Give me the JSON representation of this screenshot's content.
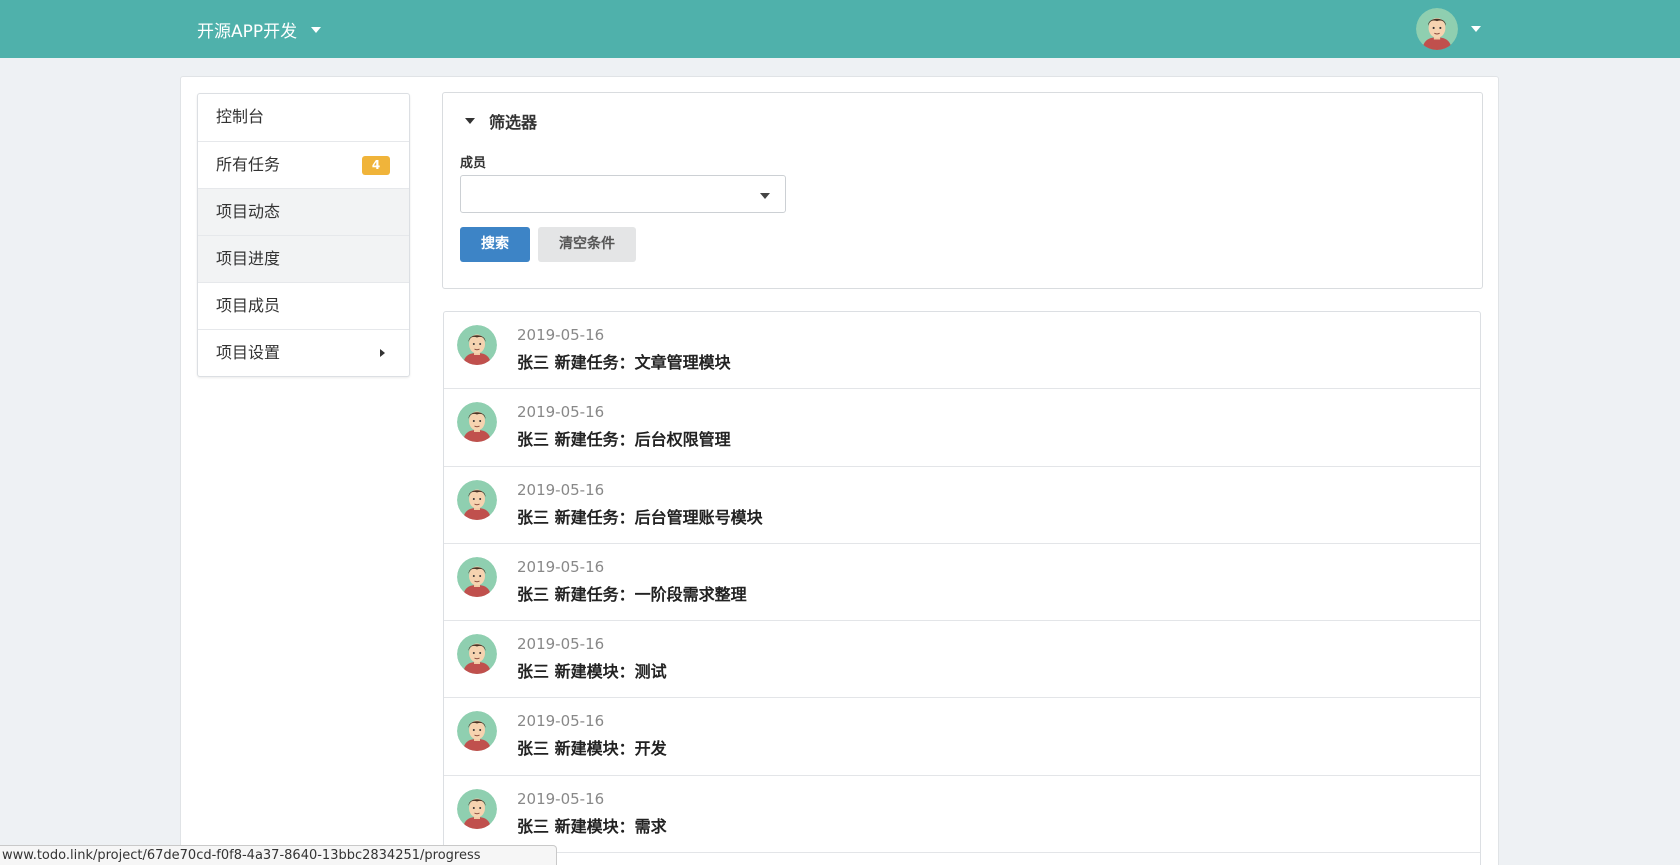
{
  "header": {
    "project_name": "开源APP开发",
    "colors": {
      "bar": "#4fb1ab",
      "avatar_bg": "#8fcfb0"
    }
  },
  "sidebar": {
    "items": [
      {
        "label": "控制台"
      },
      {
        "label": "所有任务",
        "badge": "4"
      },
      {
        "label": "项目动态"
      },
      {
        "label": "项目进度"
      },
      {
        "label": "项目成员"
      },
      {
        "label": "项目设置"
      }
    ]
  },
  "filter": {
    "title": "筛选器",
    "member_label": "成员",
    "member_value": "",
    "search_label": "搜索",
    "clear_label": "清空条件"
  },
  "activities": [
    {
      "date": "2019-05-16",
      "text": "张三 新建任务：文章管理模块"
    },
    {
      "date": "2019-05-16",
      "text": "张三 新建任务：后台权限管理"
    },
    {
      "date": "2019-05-16",
      "text": "张三 新建任务：后台管理账号模块"
    },
    {
      "date": "2019-05-16",
      "text": "张三 新建任务：一阶段需求整理"
    },
    {
      "date": "2019-05-16",
      "text": "张三 新建模块：测试"
    },
    {
      "date": "2019-05-16",
      "text": "张三 新建模块：开发"
    },
    {
      "date": "2019-05-16",
      "text": "张三 新建模块：需求"
    }
  ],
  "status_url": "www.todo.link/project/67de70cd-f0f8-4a37-8640-13bbc2834251/progress"
}
